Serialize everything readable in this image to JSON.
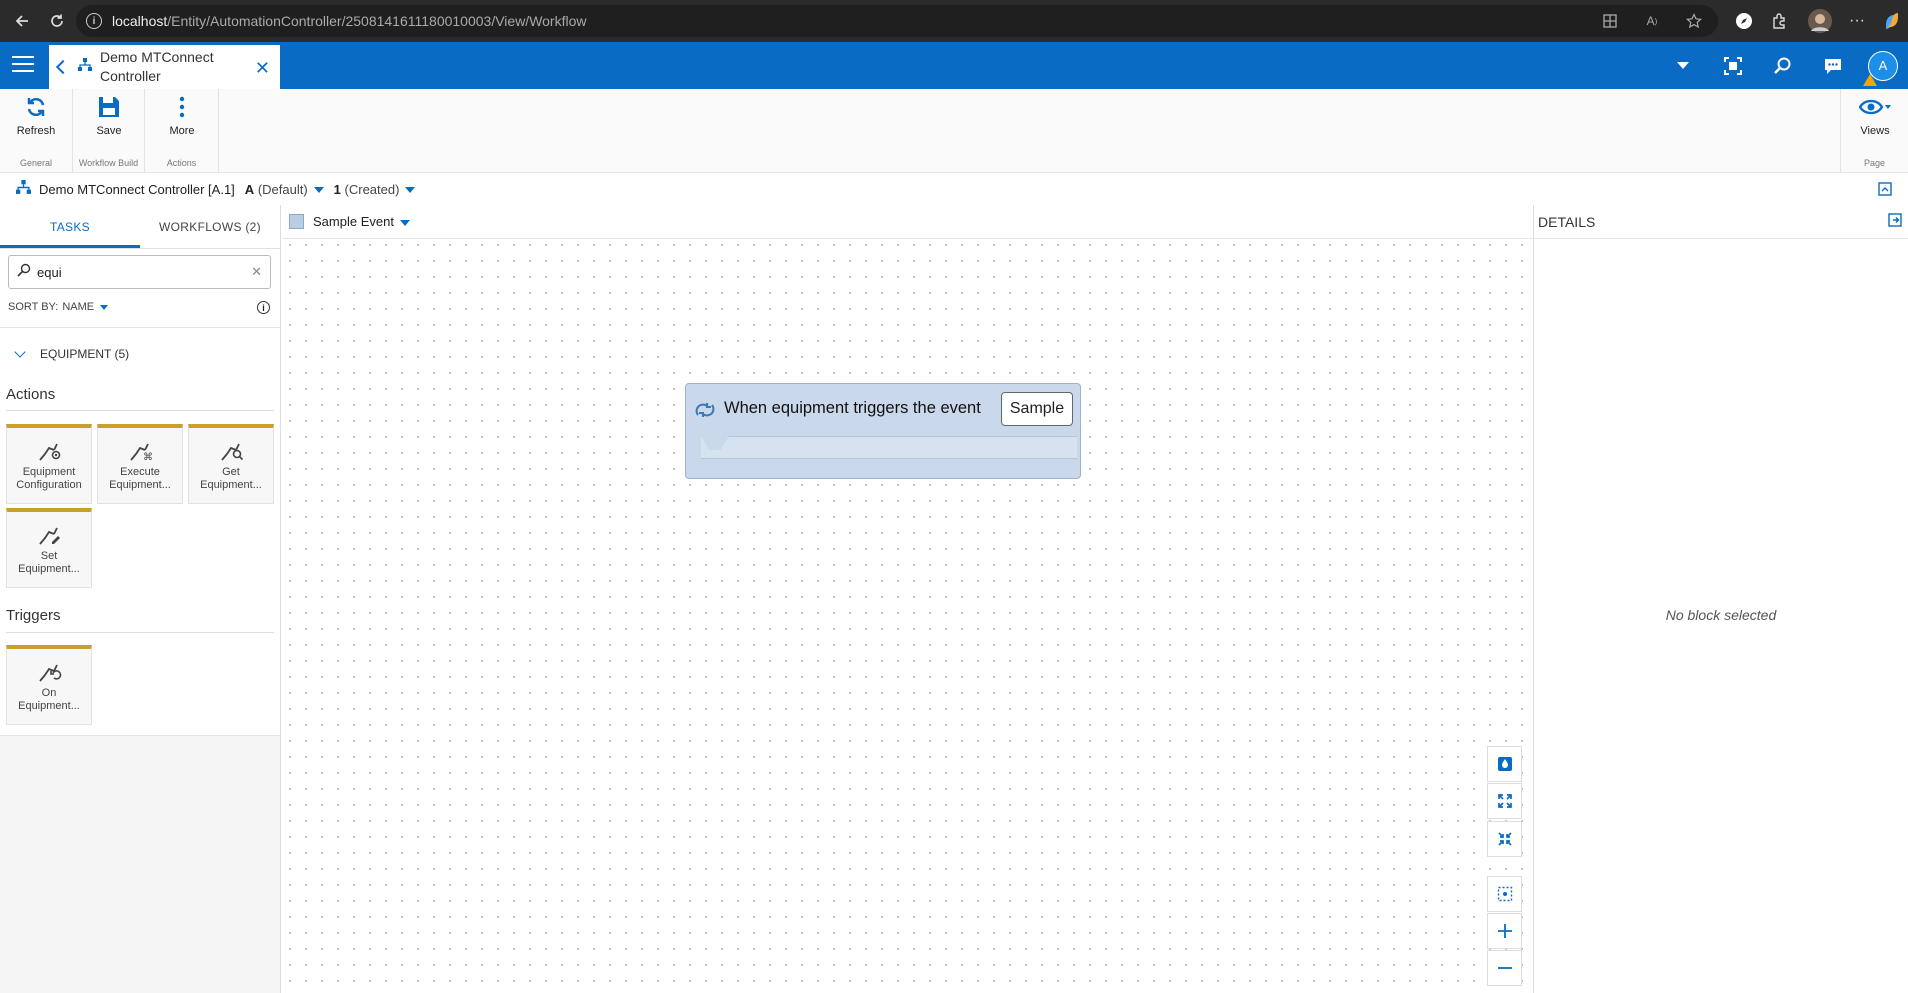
{
  "browser": {
    "url_host": "localhost",
    "url_path": "/Entity/AutomationController/2508141611180010003/View/Workflow"
  },
  "header": {
    "tab_title": "Demo MTConnect Controller",
    "avatar_initial": "A"
  },
  "ribbon": {
    "refresh_label": "Refresh",
    "save_label": "Save",
    "more_label": "More",
    "group_general": "General",
    "group_workflow_build": "Workflow Build",
    "group_actions": "Actions",
    "views_label": "Views",
    "group_page": "Page"
  },
  "context": {
    "entity": "Demo MTConnect Controller [A.1]",
    "version_key": "A",
    "version_value": "(Default)",
    "revision_key": "1",
    "revision_value": "(Created)"
  },
  "left_panel": {
    "tab_tasks": "TASKS",
    "tab_workflows": "WORKFLOWS (2)",
    "search_value": "equi",
    "sort_label": "SORT BY:",
    "sort_value": "NAME",
    "group_label": "EQUIPMENT (5)",
    "actions_heading": "Actions",
    "triggers_heading": "Triggers",
    "actions": [
      {
        "line1": "Equipment",
        "line2": "Configuration"
      },
      {
        "line1": "Execute",
        "line2": "Equipment..."
      },
      {
        "line1": "Get",
        "line2": "Equipment..."
      },
      {
        "line1": "Set",
        "line2": "Equipment..."
      }
    ],
    "triggers": [
      {
        "line1": "On",
        "line2": "Equipment..."
      }
    ]
  },
  "canvas": {
    "workflow_select": "Sample Event",
    "block_text": "When equipment triggers the event",
    "block_chip": "Sample"
  },
  "details": {
    "title": "DETAILS",
    "empty_text": "No block selected"
  },
  "colors": {
    "brand_blue": "#0a6bc5",
    "task_accent": "#c8a02a",
    "block_fill": "#c9d8ea"
  }
}
